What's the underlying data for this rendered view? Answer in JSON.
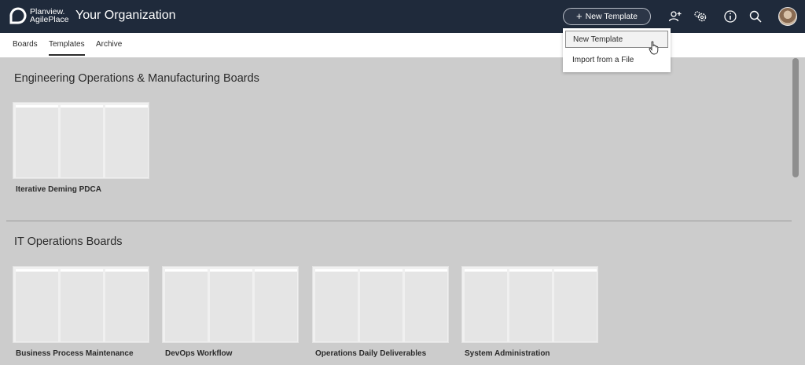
{
  "header": {
    "logo_line1": "Planview.",
    "logo_line2": "AgilePlace",
    "org_title": "Your Organization",
    "new_template_label": "New Template",
    "icons": [
      "add-user-icon",
      "settings-cog-icon",
      "info-icon",
      "search-icon",
      "user-avatar"
    ]
  },
  "subnav": {
    "items": [
      {
        "label": "Boards",
        "active": false
      },
      {
        "label": "Templates",
        "active": true
      },
      {
        "label": "Archive",
        "active": false
      }
    ]
  },
  "dropdown": {
    "items": [
      {
        "label": "New Template"
      },
      {
        "label": "Import from a File"
      }
    ]
  },
  "sections": [
    {
      "title": "Engineering Operations & Manufacturing Boards",
      "templates": [
        {
          "name": "Iterative Deming PDCA"
        }
      ]
    },
    {
      "title": "IT Operations Boards",
      "templates": [
        {
          "name": "Business Process Maintenance"
        },
        {
          "name": "DevOps Workflow"
        },
        {
          "name": "Operations Daily Deliverables"
        },
        {
          "name": "System Administration"
        }
      ]
    }
  ],
  "colors": {
    "topbar": "#1f2a3b",
    "page_background": "#cccccc",
    "card_background": "#f0f0f0"
  }
}
